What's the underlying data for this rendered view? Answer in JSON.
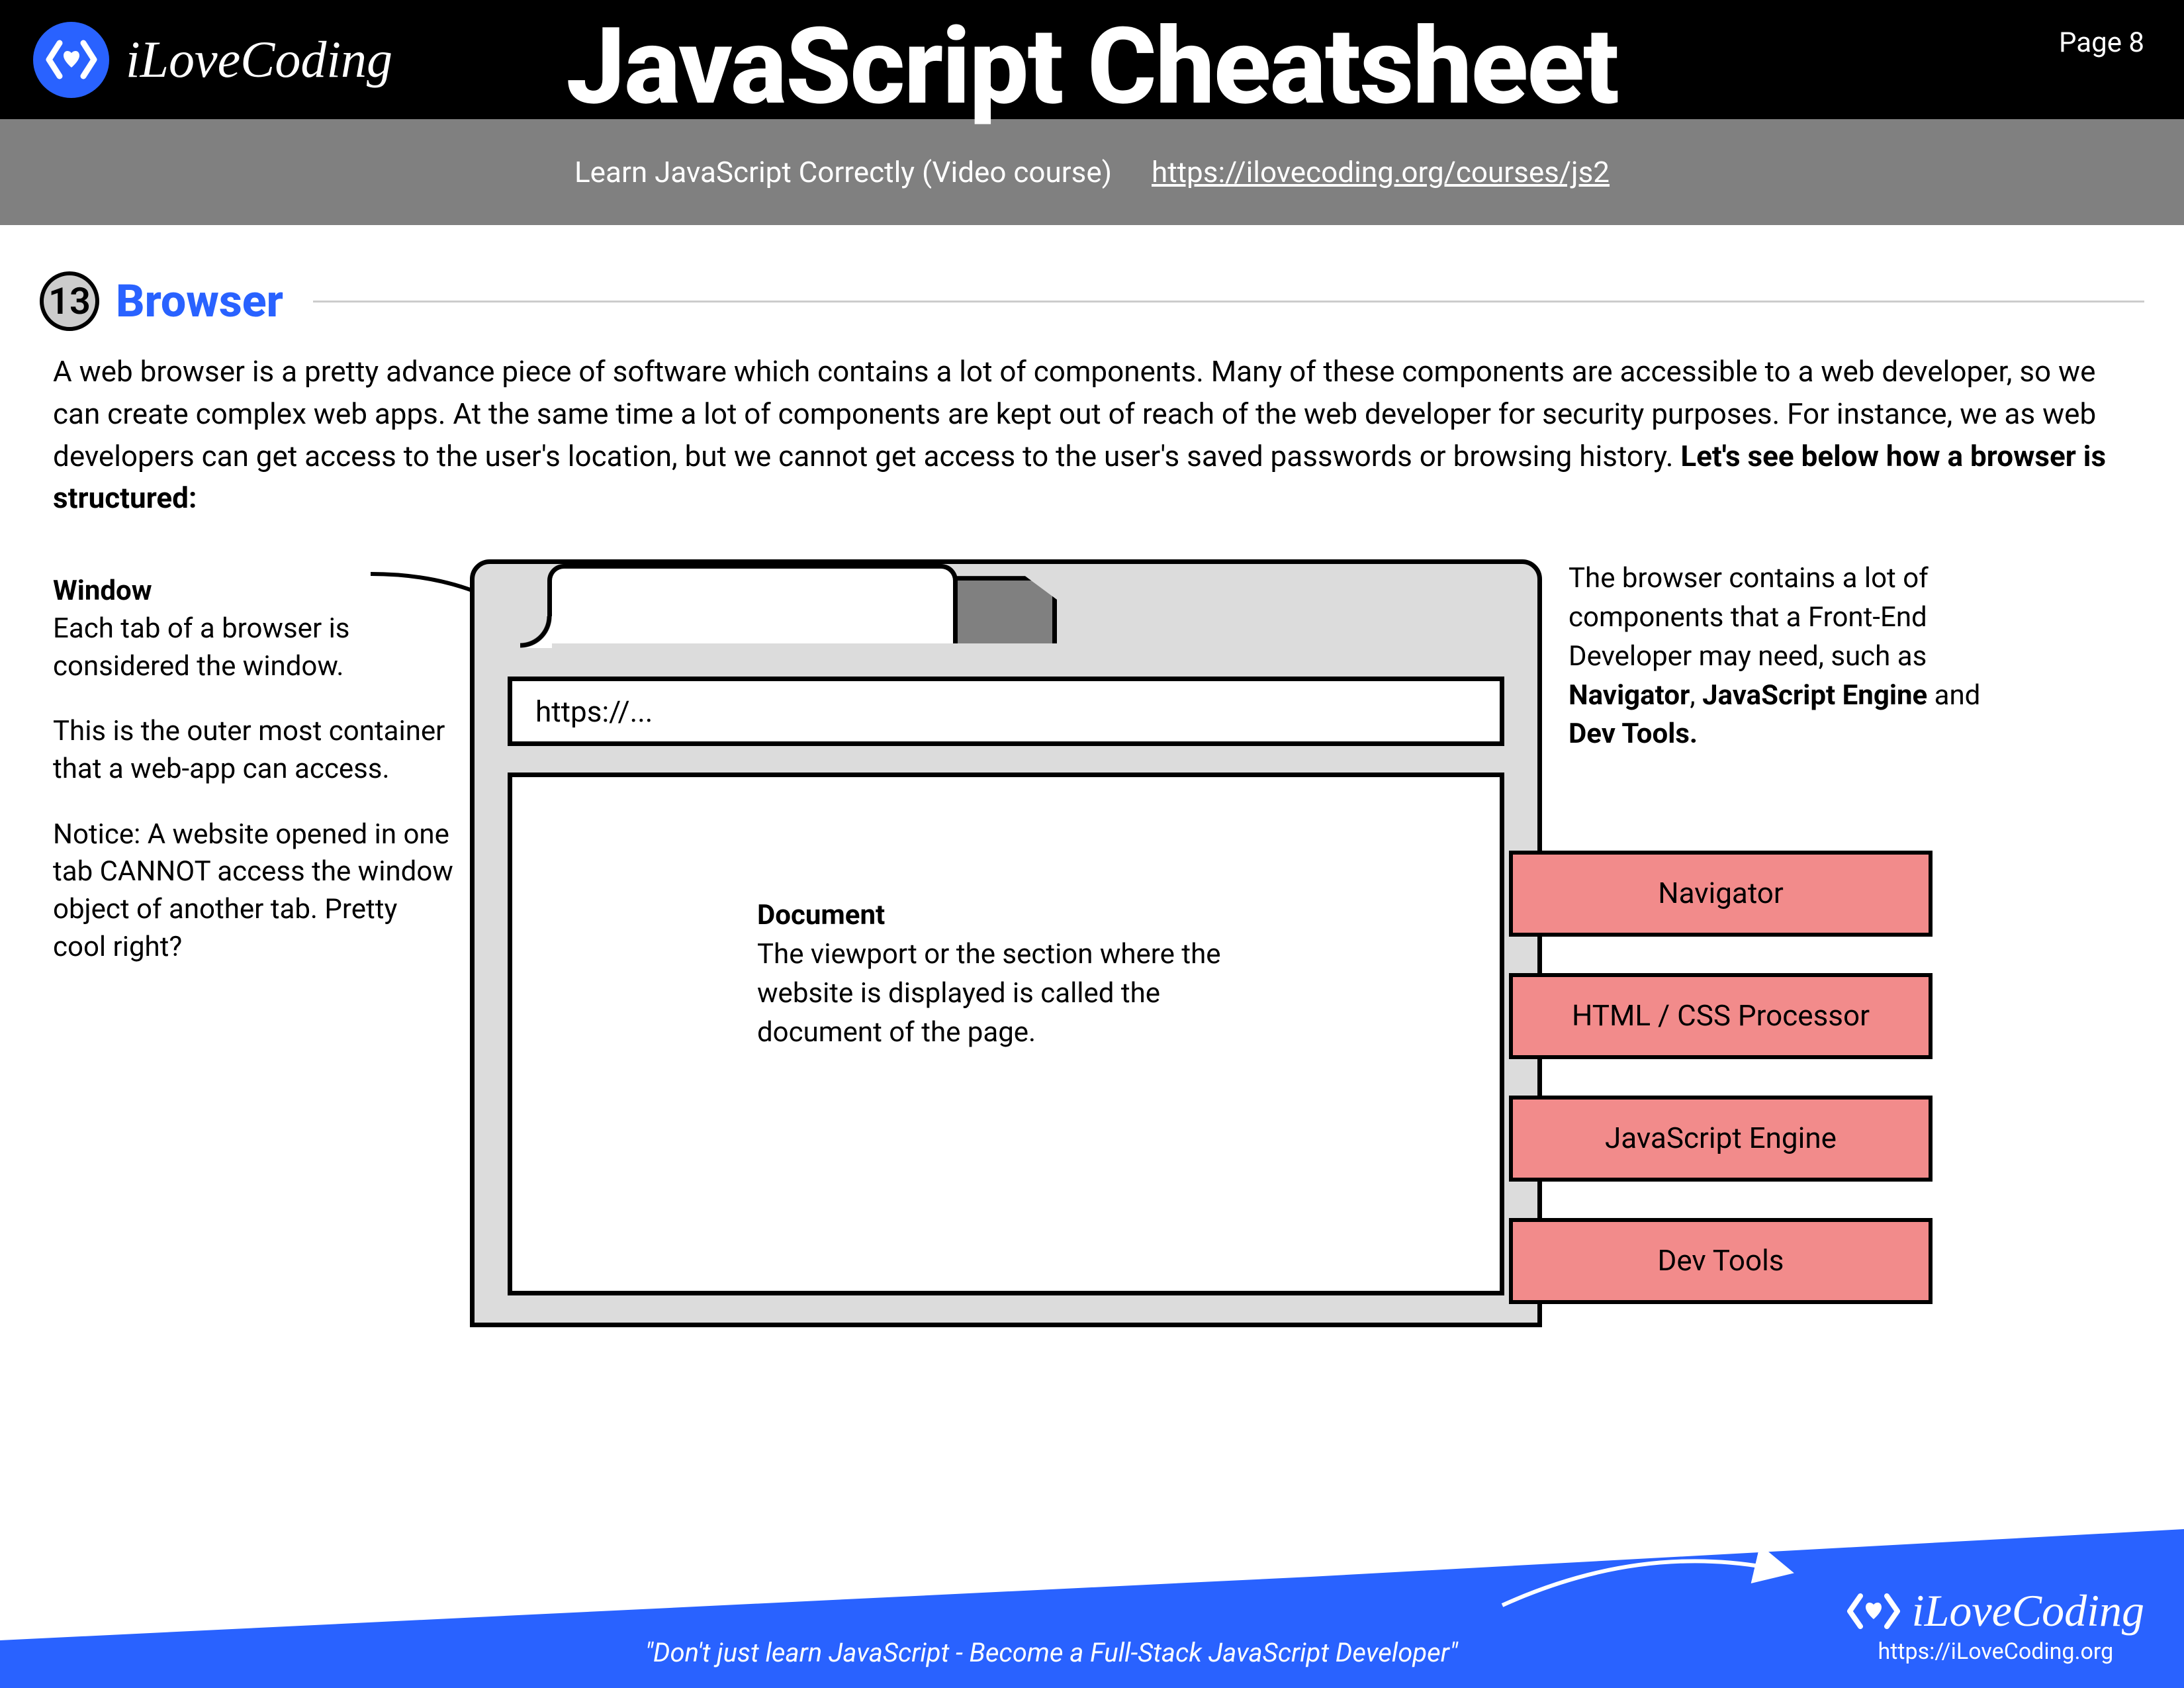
{
  "header": {
    "brand": "iLoveCoding",
    "title": "JavaScript Cheatsheet",
    "page_label": "Page 8"
  },
  "subheader": {
    "text": "Learn JavaScript Correctly (Video course)",
    "link": "https://ilovecoding.org/courses/js2"
  },
  "section": {
    "number": "13",
    "title": "Browser"
  },
  "body_paragraph": {
    "text": "A web browser is a pretty advance piece of software which contains a lot of components. Many of these components are accessible to a web developer, so we can create complex web apps. At the same time a lot of components are kept out of reach of the web developer for security purposes. For instance, we as web developers can get access to the user's location, but we cannot get access to the user's saved passwords or browsing history. ",
    "bold": "Let's see below how a browser is structured:"
  },
  "window_annotation": {
    "label": "Window",
    "p1": "Each tab of a browser is considered the window.",
    "p2": "This is the outer most container that a web-app can access.",
    "p3": "Notice: A website opened in one tab CANNOT access the window object of another tab. Pretty cool right?"
  },
  "browser_mock": {
    "url_placeholder": "https://..."
  },
  "document_annotation": {
    "label": "Document",
    "text": "The viewport or the section where the website is displayed is called the document of the page."
  },
  "right_annotation": {
    "prefix": "The browser contains a lot of components that a Front-End Developer may need, such as ",
    "b1": "Navigator",
    "mid1": ", ",
    "b2": "JavaScript Engine",
    "mid2": " and ",
    "b3": "Dev Tools."
  },
  "components": [
    "Navigator",
    "HTML / CSS Processor",
    "JavaScript Engine",
    "Dev Tools"
  ],
  "footer": {
    "quote": "\"Don't just learn JavaScript - Become a Full-Stack JavaScript Developer\"",
    "brand": "iLoveCoding",
    "url": "https://iLoveCoding.org"
  }
}
